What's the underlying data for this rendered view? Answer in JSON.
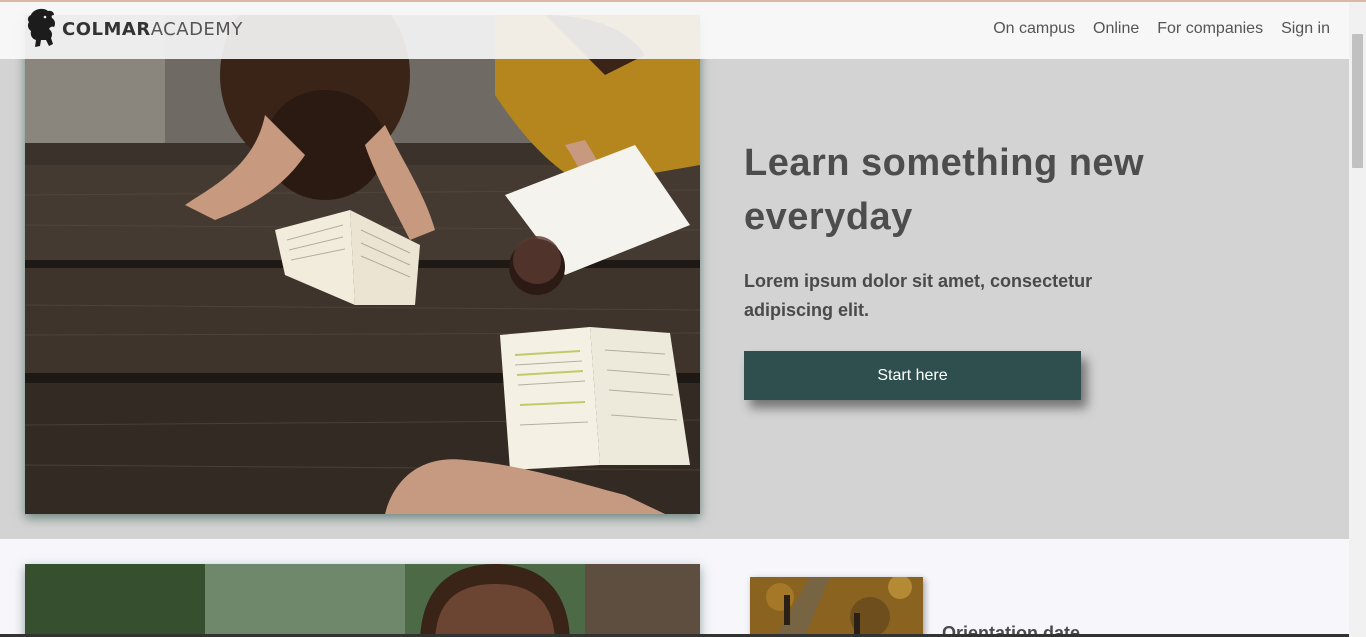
{
  "header": {
    "logo_text_bold": "COLMAR",
    "logo_text_light": "ACADEMY",
    "logo_icon": "lion-icon",
    "nav": [
      "On campus",
      "Online",
      "For companies",
      "Sign in"
    ]
  },
  "hero": {
    "title": "Learn something new everyday",
    "subtitle": "Lorem ipsum dolor sit amet, consectetur adipiscing elit.",
    "cta_label": "Start here",
    "image": "students-reading-at-table-photo"
  },
  "section2": {
    "image": "student-portrait-photo",
    "thumb_image": "autumn-path-photo",
    "orientation_label": "Orientation date"
  },
  "colors": {
    "hero_bg": "#d3d3d3",
    "cta_bg": "#2f4f4f",
    "text": "#4d4d4d",
    "page_bg": "#f6f6fb"
  }
}
